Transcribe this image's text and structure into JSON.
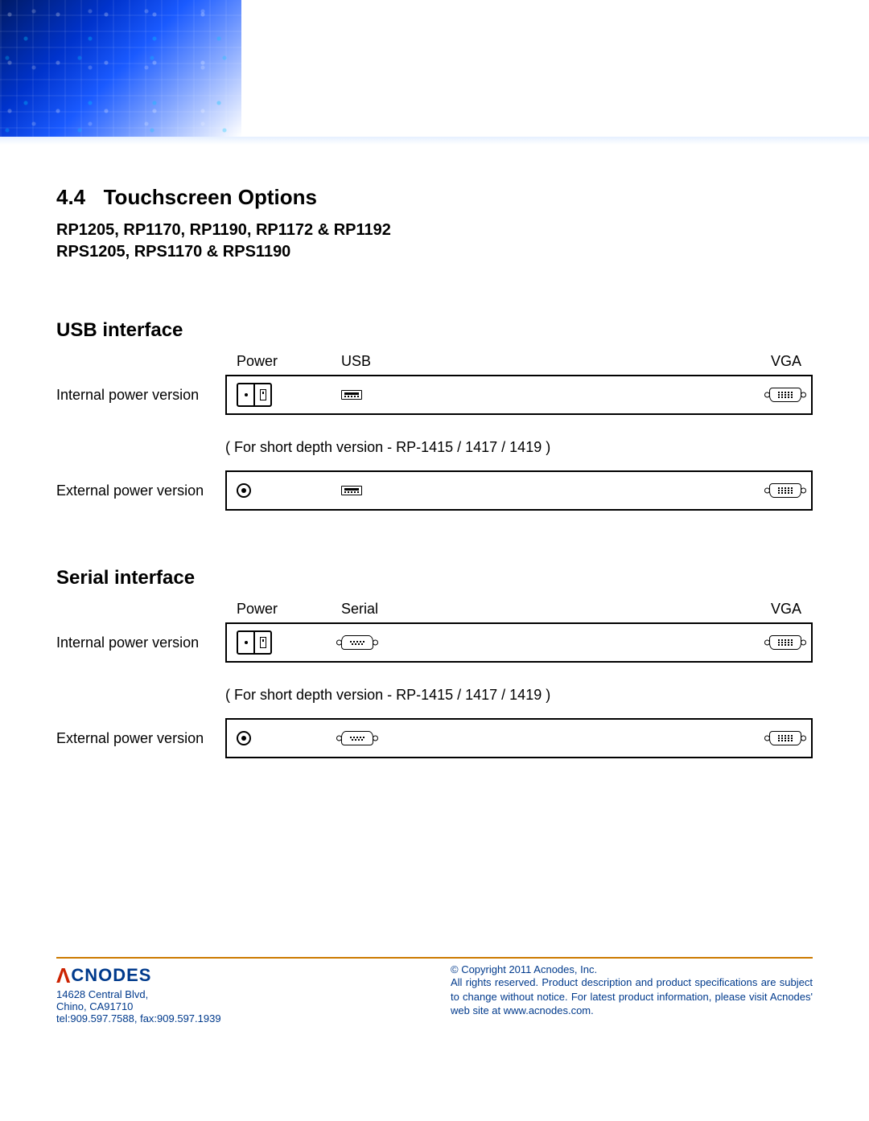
{
  "section": {
    "number": "4.4",
    "title": "Touchscreen Options"
  },
  "models": {
    "line1": "RP1205, RP1170, RP1190, RP1172 & RP1192",
    "line2": "RPS1205, RPS1170 & RPS1190"
  },
  "usb": {
    "heading": "USB interface",
    "labels": {
      "power": "Power",
      "data": "USB",
      "video": "VGA"
    },
    "row_internal": "Internal power version",
    "note": "( For short depth version - RP-1415 / 1417 / 1419 )",
    "row_external": "External power version"
  },
  "serial": {
    "heading": "Serial interface",
    "labels": {
      "power": "Power",
      "data": "Serial",
      "video": "VGA"
    },
    "row_internal": "Internal power version",
    "note": "( For short depth version - RP-1415 / 1417 / 1419 )",
    "row_external": "External power version"
  },
  "footer": {
    "brand": "CNODES",
    "address1": "14628 Central Blvd,",
    "address2": "Chino, CA91710",
    "contact": "tel:909.597.7588, fax:909.597.1939",
    "copyright": "© Copyright 2011 Acnodes, Inc.",
    "legal": "All rights reserved. Product description and product specifications are subject to change without notice. For latest product information, please visit Acnodes' web site at www.acnodes.com."
  }
}
